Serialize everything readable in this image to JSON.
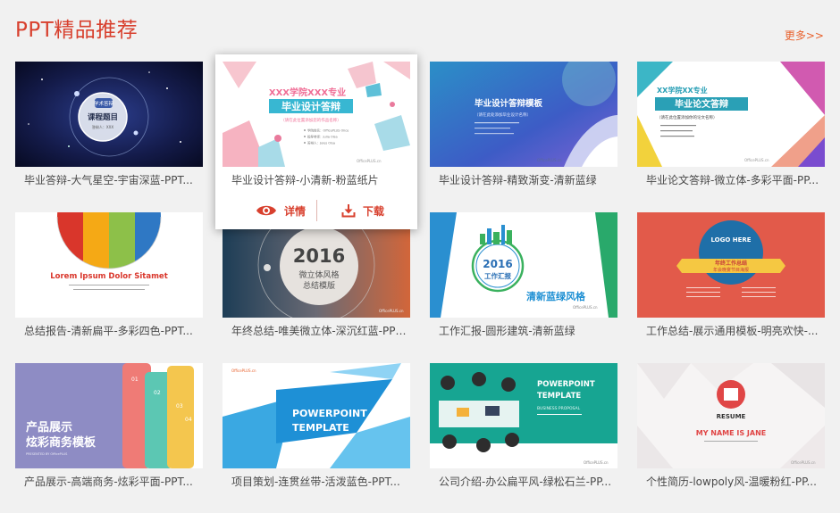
{
  "header": {
    "title": "PPT精品推荐",
    "more_label": "更多>>"
  },
  "hover_actions": {
    "details_label": "详情",
    "download_label": "下载"
  },
  "cards": [
    {
      "caption": "毕业答辩-大气星空-宇宙深蓝-PPT...",
      "thumb": {
        "lines": [
          "学术答辩",
          "课程题目",
          "答辩人：XXX"
        ]
      }
    },
    {
      "caption": "毕业设计答辩-小清新-粉蓝纸片",
      "thumb": {
        "lines": [
          "XXX学院XXX专业",
          "毕业设计答辩",
          "（请在此位置添加您的作品名称）",
          "学院姓名：OfficePLUS Olice",
          "指导老师：Julia Olsa",
          "答辩人：Jules Olsa",
          "OfficePLUS.cn"
        ]
      }
    },
    {
      "caption": "毕业设计答辩-精致渐变-清新蓝绿",
      "thumb": {
        "lines": [
          "毕业设计答辩模板",
          "（请在此处添加毕业设计名称）",
          "OfficePLUS.cn"
        ]
      }
    },
    {
      "caption": "毕业论文答辩-微立体-多彩平面-PP...",
      "thumb": {
        "lines": [
          "XX学院XX专业",
          "毕业论文答辩",
          "（请在此位置添加你的论文名称）",
          "OfficePLUS.cn"
        ]
      }
    },
    {
      "caption": "总结报告-清新扁平-多彩四色-PPT...",
      "thumb": {
        "lines": [
          "Lorem Ipsum Dolor Sitamet"
        ]
      }
    },
    {
      "caption": "年终总结-唯美微立体-深沉红蓝-PPT...",
      "thumb": {
        "lines": [
          "2016",
          "微立体风格",
          "总结模版",
          "OfficePLUS.cn"
        ]
      }
    },
    {
      "caption": "工作汇报-圆形建筑-清新蓝绿",
      "thumb": {
        "lines": [
          "2016",
          "工作汇报",
          "清新蓝绿风格",
          "OfficePLUS.cn"
        ]
      }
    },
    {
      "caption": "工作总结-展示通用模板-明亮欢快-...",
      "thumb": {
        "lines": [
          "LOGO HERE",
          "年终工作总结",
          "年会晚宴节目海报"
        ]
      }
    },
    {
      "caption": "产品展示-高端商务-炫彩平面-PPT...",
      "thumb": {
        "lines": [
          "产品展示",
          "炫彩商务模板",
          "PRESENTED BY OfficePLUS",
          "01",
          "02",
          "03",
          "04"
        ]
      }
    },
    {
      "caption": "项目策划-连贯丝带-活泼蓝色-PPT...",
      "thumb": {
        "lines": [
          "POWERPOINT",
          "TEMPLATE",
          "OfficePLUS.cn"
        ]
      }
    },
    {
      "caption": "公司介绍-办公扁平风-绿松石兰-PP...",
      "thumb": {
        "lines": [
          "POWERPOINT",
          "TEMPLATE",
          "BUSINESS PROPOSAL",
          "OfficePLUS.cn"
        ]
      }
    },
    {
      "caption": "个性简历-lowpoly风-温暖粉红-PP...",
      "thumb": {
        "lines": [
          "RESUME",
          "MY NAME IS JANE",
          "OfficePLUS.cn"
        ]
      }
    }
  ],
  "colors": {
    "title": "#d8402e",
    "more": "#e8622e",
    "caption": "#4a4a4a",
    "action": "#d8402e",
    "background": "#f1f1f1"
  }
}
